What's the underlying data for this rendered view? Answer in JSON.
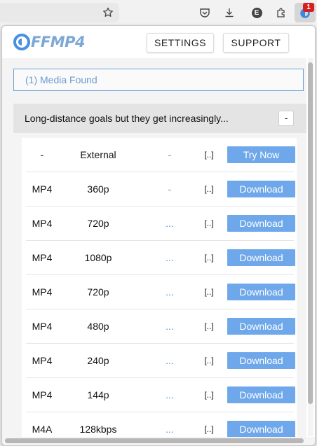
{
  "toolbar": {
    "icons": [
      "star-icon",
      "pocket-icon",
      "download-icon",
      "extension-e-icon",
      "puzzle-icon",
      "ffmp4-extension-icon"
    ],
    "extension_initial": "E",
    "badge_count": "1"
  },
  "popup": {
    "logo": {
      "text": "FFMP4",
      "accent": "#4b8fe0"
    },
    "buttons": {
      "settings": "SETTINGS",
      "support": "SUPPORT"
    },
    "media_found": "(1) Media Found",
    "item": {
      "title": "Long-distance goals but they get increasingly...",
      "collapse_label": "-"
    },
    "rows": [
      {
        "format": "-",
        "quality": "External",
        "size": "-",
        "bitrate": "[..]",
        "action": "Try Now"
      },
      {
        "format": "MP4",
        "quality": "360p",
        "size": "-",
        "bitrate": "[..]",
        "action": "Download"
      },
      {
        "format": "MP4",
        "quality": "720p",
        "size": "...",
        "bitrate": "[..]",
        "action": "Download"
      },
      {
        "format": "MP4",
        "quality": "1080p",
        "size": "...",
        "bitrate": "[..]",
        "action": "Download"
      },
      {
        "format": "MP4",
        "quality": "720p",
        "size": "...",
        "bitrate": "[..]",
        "action": "Download"
      },
      {
        "format": "MP4",
        "quality": "480p",
        "size": "...",
        "bitrate": "[..]",
        "action": "Download"
      },
      {
        "format": "MP4",
        "quality": "240p",
        "size": "...",
        "bitrate": "[..]",
        "action": "Download"
      },
      {
        "format": "MP4",
        "quality": "144p",
        "size": "...",
        "bitrate": "[..]",
        "action": "Download"
      },
      {
        "format": "M4A",
        "quality": "128kbps",
        "size": "...",
        "bitrate": "[..]",
        "action": "Download"
      }
    ],
    "colors": {
      "button": "#6fa8ea",
      "link": "#4b8fe0",
      "badge": "#d42020"
    }
  }
}
